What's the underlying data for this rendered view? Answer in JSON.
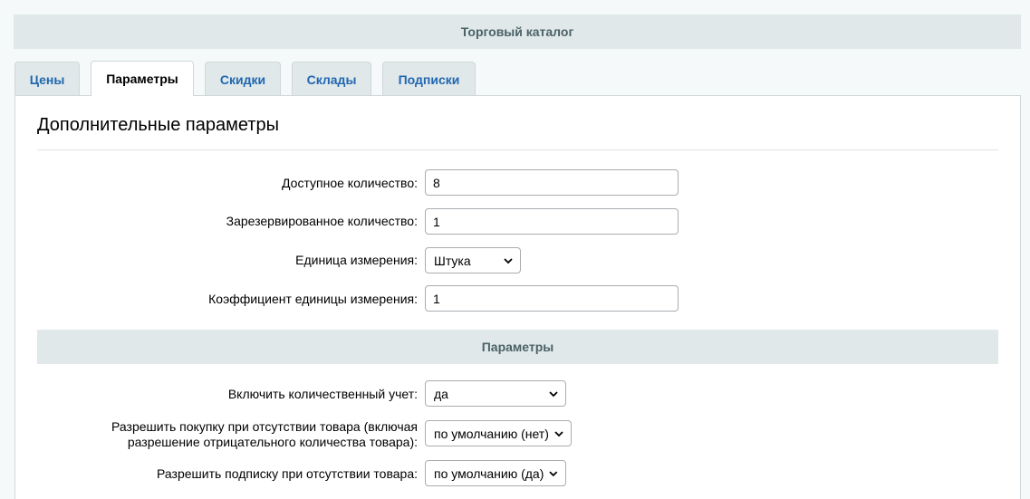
{
  "header": {
    "title": "Торговый каталог"
  },
  "tabs": [
    {
      "label": "Цены"
    },
    {
      "label": "Параметры",
      "active": true
    },
    {
      "label": "Скидки"
    },
    {
      "label": "Склады"
    },
    {
      "label": "Подписки"
    }
  ],
  "panel": {
    "title": "Дополнительные параметры",
    "available_qty": {
      "label": "Доступное количество:",
      "value": "8"
    },
    "reserved_qty": {
      "label": "Зарезервированное количество:",
      "value": "1"
    },
    "unit": {
      "label": "Единица измерения:",
      "value": "Штука"
    },
    "unit_ratio": {
      "label": "Коэффициент единицы измерения:",
      "value": "1"
    },
    "params_header": "Параметры",
    "qty_trace": {
      "label": "Включить количественный учет:",
      "value": "да"
    },
    "can_buy_zero": {
      "label_line1": "Разрешить покупку при отсутствии товара (включая",
      "label_line2": "разрешение отрицательного количества товара):",
      "value": "по умолчанию (нет)"
    },
    "subscribe": {
      "label": "Разрешить подписку при отсутствии товара:",
      "value": "по умолчанию (да)"
    }
  },
  "icons": {
    "select_arrow": "chevron-down-icon"
  }
}
